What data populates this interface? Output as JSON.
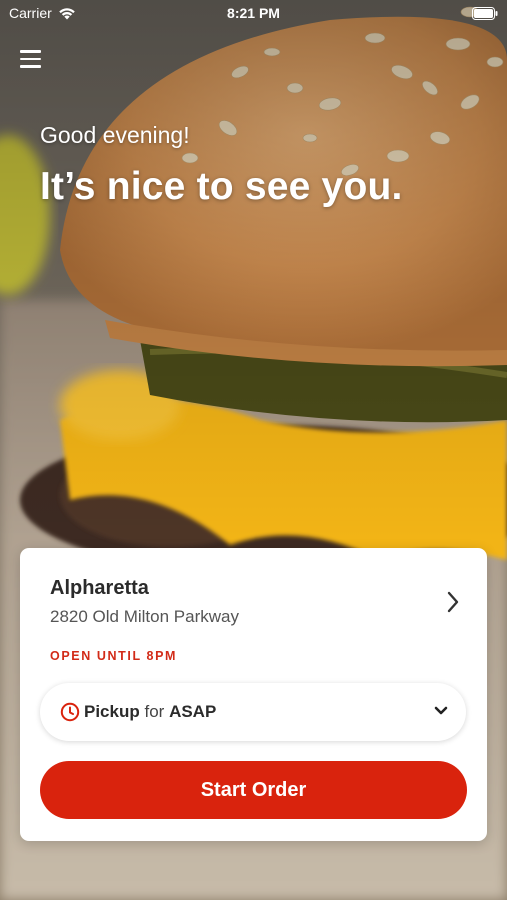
{
  "status_bar": {
    "carrier": "Carrier",
    "time": "8:21 PM",
    "icons": [
      "wifi-icon",
      "battery-icon"
    ]
  },
  "header": {
    "menu_icon": "hamburger-menu-icon"
  },
  "hero": {
    "greeting": "Good evening!",
    "headline": "It’s nice to see you."
  },
  "location_card": {
    "store_name": "Alpharetta",
    "address": "2820 Old Milton Parkway",
    "hours": "OPEN UNTIL 8PM",
    "order_mode": {
      "mode": "Pickup",
      "connector": "for",
      "timing": "ASAP"
    },
    "start_button_label": "Start Order"
  },
  "colors": {
    "accent": "#d9230d",
    "hours_text": "#d22b18",
    "card_bg": "#ffffff"
  }
}
